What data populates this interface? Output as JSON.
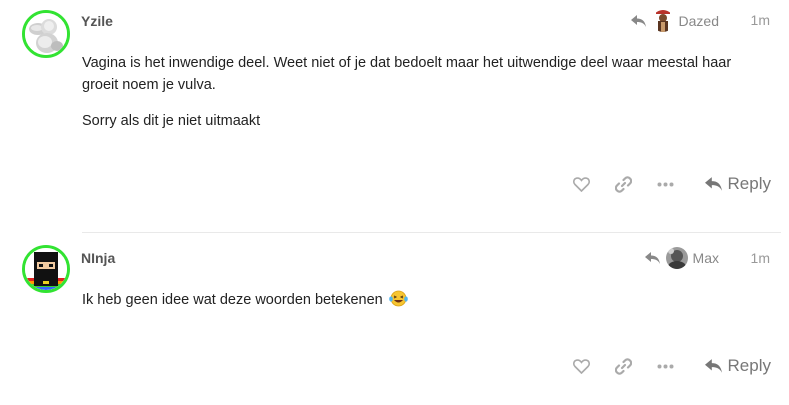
{
  "posts": [
    {
      "username": "Yzile",
      "reply_to_user": "Dazed",
      "date": "1m",
      "paragraphs": [
        "Vagina is het inwendige deel. Weet niet of je dat bedoelt maar het uitwendige deel waar meestal haar groeit noem je vulva.",
        "Sorry als dit je niet uitmaakt"
      ],
      "reply_label": "Reply",
      "avatar_icon": "cherub-statue-avatar",
      "reply_avatar_icon": "figure-avatar"
    },
    {
      "username": "NInja",
      "reply_to_user": "Max",
      "date": "1m",
      "paragraphs": [
        "Ik heb geen idee wat deze woorden betekenen"
      ],
      "emoji": "laughing-with-tears-emoji",
      "reply_label": "Reply",
      "avatar_icon": "pixel-ninja-avatar",
      "reply_avatar_icon": "photo-avatar"
    }
  ],
  "colors": {
    "avatar_ring": "#32e332",
    "username": "#555555",
    "muted": "#999999",
    "action_icons": "#aaaaaa",
    "reply": "#777777"
  }
}
